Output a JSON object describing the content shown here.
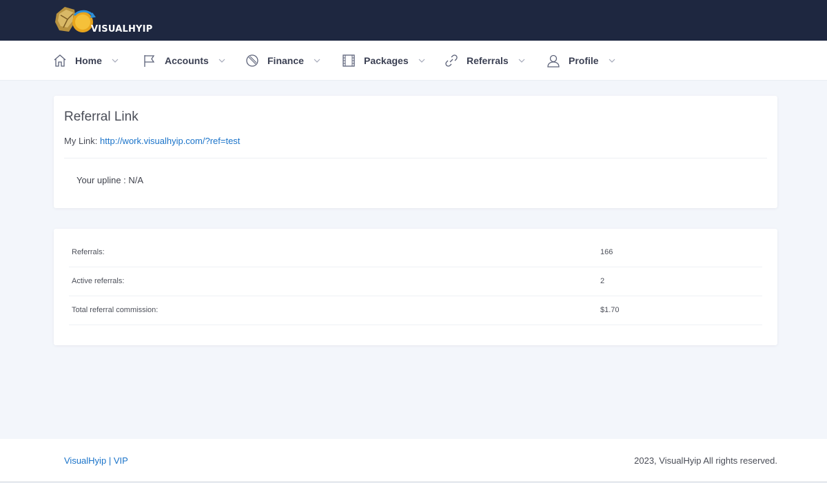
{
  "header": {
    "brand": "VISUALHYIP",
    "logo_icon": "hexagon-coin-logo"
  },
  "nav": {
    "items": [
      {
        "label": "Home",
        "icon": "home-icon"
      },
      {
        "label": "Accounts",
        "icon": "flag-icon"
      },
      {
        "label": "Finance",
        "icon": "coin-icon"
      },
      {
        "label": "Packages",
        "icon": "film-icon"
      },
      {
        "label": "Referrals",
        "icon": "link-icon"
      },
      {
        "label": "Profile",
        "icon": "user-icon"
      }
    ],
    "chevron_icon": "chevron-down-icon"
  },
  "referral": {
    "title": "Referral Link",
    "link_label": "My Link:",
    "link_url": "http://work.visualhyip.com/?ref=test",
    "upline": "Your upline : N/A"
  },
  "stats": {
    "rows": [
      {
        "label": "Referrals:",
        "value": "166"
      },
      {
        "label": "Active referrals:",
        "value": "2"
      },
      {
        "label": "Total referral commission:",
        "value": "$1.70"
      }
    ]
  },
  "footer": {
    "left_link_1": "VisualHyip",
    "separator": "|",
    "left_link_2": "VIP",
    "copyright": "2023, VisualHyip All rights reserved."
  },
  "colors": {
    "topbar": "#1e2740",
    "link": "#1a73c9",
    "background": "#f3f6fb"
  }
}
